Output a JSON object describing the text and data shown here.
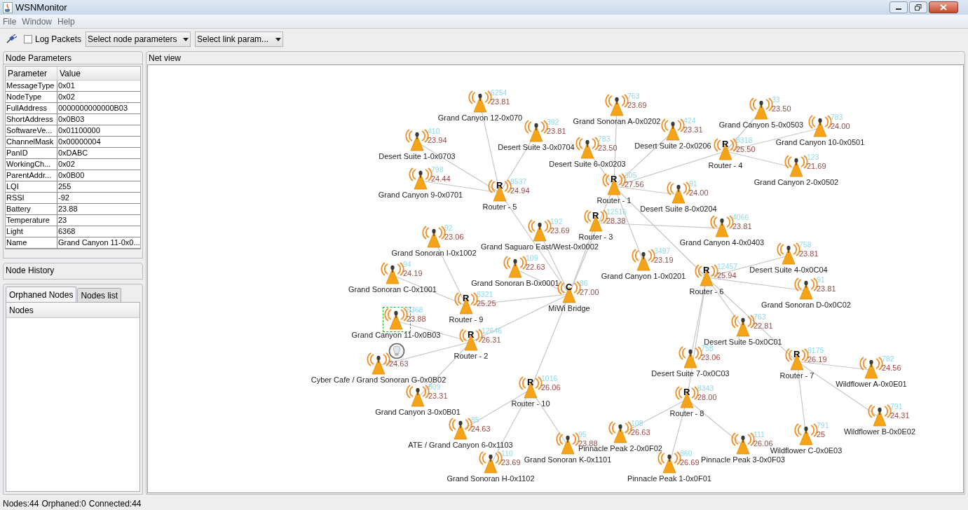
{
  "window": {
    "title": "WSNMonitor"
  },
  "menu": [
    "File",
    "Window",
    "Help"
  ],
  "toolbar": {
    "log_packets": {
      "label": "Log Packets",
      "checked": false
    },
    "node_param_select": "Select node parameters",
    "link_param_select": "Select link param..."
  },
  "node_parameters": {
    "title": "Node Parameters",
    "columns": [
      "Parameter",
      "Value"
    ],
    "rows": [
      [
        "MessageType",
        "0x01"
      ],
      [
        "NodeType",
        "0x02"
      ],
      [
        "FullAddress",
        "0000000000000B03"
      ],
      [
        "ShortAddress",
        "0x0B03"
      ],
      [
        "SoftwareVe...",
        "0x01100000"
      ],
      [
        "ChannelMask",
        "0x00000004"
      ],
      [
        "PanID",
        "0xDABC"
      ],
      [
        "WorkingCh...",
        "0x02"
      ],
      [
        "ParentAddr...",
        "0x0B00"
      ],
      [
        "LQI",
        "255"
      ],
      [
        "RSSI",
        "-92"
      ],
      [
        "Battery",
        "23.88"
      ],
      [
        "Temperature",
        "23"
      ],
      [
        "Light",
        "6368"
      ],
      [
        "Name",
        "Grand Canyon 11-0x0..."
      ]
    ]
  },
  "node_history": {
    "title": "Node History"
  },
  "lists_panel": {
    "tabs": [
      {
        "label": "Orphaned Nodes",
        "selected": true
      },
      {
        "label": "Nodes list",
        "selected": false
      }
    ],
    "columns": [
      "Nodes"
    ]
  },
  "net_view": {
    "title": "Net view",
    "root": {
      "kind": "coordinator",
      "symbol": "C",
      "name": "MiWi Bridge",
      "light": "86",
      "temperature": "27.00",
      "selected": false,
      "children": [
        {
          "kind": "router",
          "symbol": "R",
          "name": "Router - 1",
          "light": "305",
          "temperature": "27.56",
          "selected": false,
          "children": [
            {
              "kind": "end_device",
              "name": "Grand Sonoran A-0x0202",
              "light": "763",
              "temperature": "23.69",
              "selected": false
            },
            {
              "kind": "end_device",
              "name": "Desert Suite 2-0x0206",
              "light": "424",
              "temperature": "23.31",
              "selected": false
            },
            {
              "kind": "router",
              "symbol": "R",
              "name": "Router - 4",
              "light": "8318",
              "temperature": "25.50",
              "selected": false,
              "children": [
                {
                  "kind": "end_device",
                  "name": "Grand Canyon 5-0x0503",
                  "light": "33",
                  "temperature": "23.50",
                  "selected": false
                },
                {
                  "kind": "end_device",
                  "name": "Grand Canyon 10-0x0501",
                  "light": "783",
                  "temperature": "24.00",
                  "selected": false
                },
                {
                  "kind": "end_device",
                  "name": "Grand Canyon 2-0x0502",
                  "light": "123",
                  "temperature": "21.69",
                  "selected": false
                }
              ]
            },
            {
              "kind": "end_device",
              "name": "Desert Suite 6-0x0203",
              "light": "783",
              "temperature": "23.50",
              "selected": false
            },
            {
              "kind": "end_device",
              "name": "Desert Suite 8-0x0204",
              "light": "91",
              "temperature": "24.00",
              "selected": false
            },
            {
              "kind": "end_device",
              "name": "Grand Canyon 1-0x0201",
              "light": "3497",
              "temperature": "23.19",
              "selected": false
            },
            {
              "kind": "router",
              "symbol": "R",
              "name": "Router - 6",
              "light": "12457",
              "temperature": "25.94",
              "selected": false,
              "children": [
                {
                  "kind": "end_device",
                  "name": "Desert Suite 4-0x0C04",
                  "light": "758",
                  "temperature": "23.81",
                  "selected": false
                },
                {
                  "kind": "end_device",
                  "name": "Grand Sonoran D-0x0C02",
                  "light": "91",
                  "temperature": "23.81",
                  "selected": false
                },
                {
                  "kind": "end_device",
                  "name": "Desert Suite 5-0x0C01",
                  "light": "763",
                  "temperature": "22.81",
                  "selected": false
                },
                {
                  "kind": "end_device",
                  "name": "Desert Suite 7-0x0C03",
                  "light": "758",
                  "temperature": "23.06",
                  "selected": false
                },
                {
                  "kind": "router",
                  "symbol": "R",
                  "name": "Router - 7",
                  "light": "8175",
                  "temperature": "26.19",
                  "selected": false,
                  "children": [
                    {
                      "kind": "end_device",
                      "name": "Wildflower A-0x0E01",
                      "light": "782",
                      "temperature": "24.56",
                      "selected": false
                    },
                    {
                      "kind": "end_device",
                      "name": "Wildflower B-0x0E02",
                      "light": "791",
                      "temperature": "24.31",
                      "selected": false
                    },
                    {
                      "kind": "end_device",
                      "name": "Wildflower C-0x0E03",
                      "light": "791",
                      "temperature": "25",
                      "selected": false
                    }
                  ]
                },
                {
                  "kind": "router",
                  "symbol": "R",
                  "name": "Router - 8",
                  "light": "8343",
                  "temperature": "28.00",
                  "selected": false,
                  "children": [
                    {
                      "kind": "end_device",
                      "name": "Pinnacle Peak 2-0x0F02",
                      "light": "108",
                      "temperature": "26.63",
                      "selected": false
                    },
                    {
                      "kind": "end_device",
                      "name": "Pinnacle Peak 3-0x0F03",
                      "light": "111",
                      "temperature": "26.06",
                      "selected": false
                    },
                    {
                      "kind": "end_device",
                      "name": "Pinnacle Peak 1-0x0F01",
                      "light": "860",
                      "temperature": "26.69",
                      "selected": false
                    }
                  ]
                }
              ]
            }
          ]
        },
        {
          "kind": "router",
          "symbol": "R",
          "name": "Router - 5",
          "light": "8537",
          "temperature": "24.94",
          "selected": false,
          "children": [
            {
              "kind": "end_device",
              "name": "Grand Canyon 12-0x070",
              "light": "6254",
              "temperature": "23.81",
              "selected": false
            },
            {
              "kind": "end_device",
              "name": "Desert Suite 3-0x0704",
              "light": "392",
              "temperature": "23.81",
              "selected": false
            },
            {
              "kind": "end_device",
              "name": "Desert Suite 1-0x0703",
              "light": "410",
              "temperature": "23.94",
              "selected": false
            },
            {
              "kind": "end_device",
              "name": "Grand Canyon 9-0x0701",
              "light": "798",
              "temperature": "24.44",
              "selected": false
            }
          ]
        },
        {
          "kind": "router",
          "symbol": "R",
          "name": "Router - 3",
          "light": "12516",
          "temperature": "28.38",
          "selected": false,
          "children": [
            {
              "kind": "end_device",
              "name": "Grand Canyon 4-0x0403",
              "light": "4066",
              "temperature": "23.81",
              "selected": false
            }
          ]
        },
        {
          "kind": "end_device",
          "name": "Grand Saguaro East/West-0x0002",
          "light": "192",
          "temperature": "23.69",
          "selected": false
        },
        {
          "kind": "end_device",
          "name": "Grand Sonoran B-0x0001",
          "light": "109",
          "temperature": "22.63",
          "selected": false
        },
        {
          "kind": "router",
          "symbol": "R",
          "name": "Router - 9",
          "light": "8321",
          "temperature": "25.25",
          "selected": false,
          "children": [
            {
              "kind": "end_device",
              "name": "Grand Sonoran I-0x1002",
              "light": "92",
              "temperature": "23.06",
              "selected": false
            },
            {
              "kind": "end_device",
              "name": "Grand Sonoran C-0x1001",
              "light": "94",
              "temperature": "24.19",
              "selected": false
            }
          ]
        },
        {
          "kind": "router",
          "symbol": "R",
          "name": "Router - 2",
          "light": "12646",
          "temperature": "26.31",
          "selected": false,
          "children": [
            {
              "kind": "end_device",
              "name": "Grand Canyon 11-0x0B03",
              "light": "6368",
              "temperature": "23.88",
              "selected": true
            },
            {
              "kind": "end_device",
              "name": "Cyber Cafe / Grand Sonoran G-0x0B02",
              "temperature": "24.63",
              "selected": false,
              "lamp": true
            },
            {
              "kind": "end_device",
              "name": "Grand Canyon 3-0x0B01",
              "light": "809",
              "temperature": "23.31",
              "selected": false
            }
          ]
        },
        {
          "kind": "router",
          "symbol": "R",
          "name": "Router - 10",
          "light": "1016",
          "temperature": "26.06",
          "selected": false,
          "children": [
            {
              "kind": "end_device",
              "name": "ATE / Grand Canyon 6-0x1103",
              "light": "85",
              "temperature": "24.63",
              "selected": false
            },
            {
              "kind": "end_device",
              "name": "Grand Sonoran K-0x1101",
              "light": "95",
              "temperature": "23.88",
              "selected": false
            },
            {
              "kind": "end_device",
              "name": "Grand Sonoran H-0x1102",
              "light": "110",
              "temperature": "23.69",
              "selected": false
            }
          ]
        }
      ]
    }
  },
  "status_bar": [
    "Nodes:44",
    "Orphaned:0",
    "Connected:44"
  ]
}
